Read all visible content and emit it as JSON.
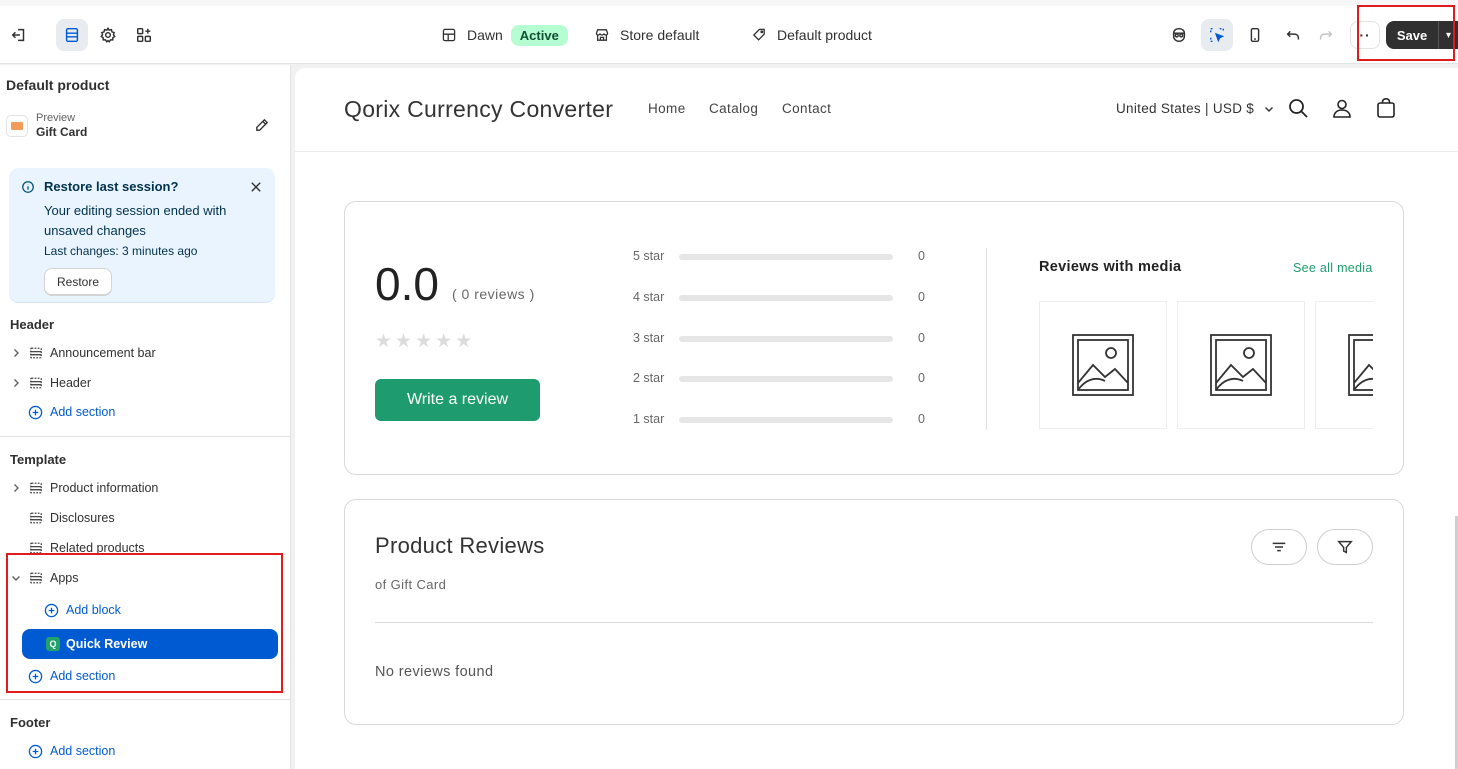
{
  "topbar": {
    "theme_name": "Dawn",
    "theme_status": "Active",
    "store_context": "Store default",
    "template_context": "Default product",
    "save_label": "Save",
    "more_label": "··"
  },
  "sidebar": {
    "title": "Default product",
    "preview_label": "Preview",
    "preview_item": "Gift Card",
    "banner": {
      "title": "Restore last session?",
      "text": "Your editing session ended with unsaved changes",
      "last_changes": "Last changes: 3 minutes ago",
      "restore_label": "Restore"
    },
    "header_group": {
      "label": "Header",
      "items": [
        "Announcement bar",
        "Header"
      ],
      "add_section": "Add section"
    },
    "template_group": {
      "label": "Template",
      "items": [
        "Product information",
        "Disclosures",
        "Related products",
        "Apps"
      ],
      "add_block": "Add block",
      "app_block": "Quick Review",
      "app_block_letter": "Q",
      "add_section": "Add section"
    },
    "footer_group": {
      "label": "Footer",
      "add_section": "Add section"
    }
  },
  "store": {
    "name": "Qorix Currency Converter",
    "nav": [
      "Home",
      "Catalog",
      "Contact"
    ],
    "locale": "United States | USD $"
  },
  "reviews_summary": {
    "score": "0.0",
    "count_text": "( 0 reviews )",
    "rating_fraction": 0,
    "write_review": "Write a review",
    "distribution": [
      {
        "label": "5 star",
        "count": "0",
        "fraction": 0
      },
      {
        "label": "4 star",
        "count": "0",
        "fraction": 0
      },
      {
        "label": "3 star",
        "count": "0",
        "fraction": 0
      },
      {
        "label": "2 star",
        "count": "0",
        "fraction": 0
      },
      {
        "label": "1 star",
        "count": "0",
        "fraction": 0
      }
    ],
    "media_title": "Reviews with media",
    "see_all": "See all media"
  },
  "product_reviews": {
    "title": "Product Reviews",
    "subtitle": "of Gift Card",
    "empty": "No reviews found"
  },
  "colors": {
    "accent": "#005bd3",
    "review_green": "#1f9c6f",
    "highlight_red": "#e11b1b",
    "banner_bg": "#eaf4ff",
    "active_badge": "#b4fed2"
  },
  "icons": {
    "exit": "exit-icon",
    "sections": "sections-icon",
    "settings": "gear-icon",
    "apps": "apps-icon",
    "layout": "layout-icon",
    "store": "store-icon",
    "tag": "tag-icon",
    "inspector": "inspector-icon",
    "select": "select-icon",
    "mobile": "mobile-icon",
    "undo": "undo-icon",
    "redo": "redo-icon",
    "search": "search-icon",
    "account": "account-icon",
    "cart": "cart-icon",
    "sort": "sort-icon",
    "filter": "filter-icon"
  }
}
